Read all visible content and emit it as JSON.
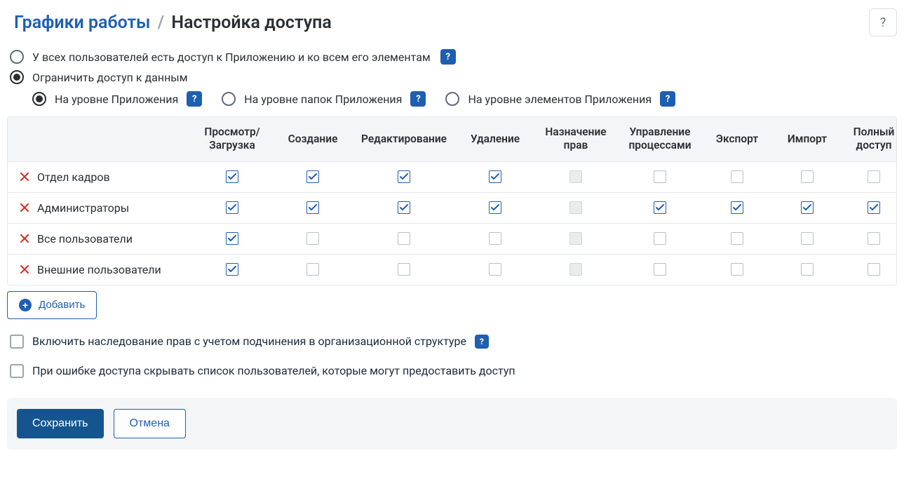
{
  "breadcrumb": {
    "parent": "Графики работы",
    "sep": "/",
    "current": "Настройка доступа"
  },
  "help_icon": "?",
  "access": {
    "opt_all": "У всех пользователей есть доступ к Приложению и ко всем его элементам",
    "opt_restrict": "Ограничить доступ к данным",
    "selected": "restrict",
    "level": {
      "app": "На уровне Приложения",
      "folders": "На уровне папок Приложения",
      "elements": "На уровне элементов Приложения",
      "selected": "app"
    }
  },
  "table": {
    "headers": {
      "name": "",
      "view": "Просмотр/\nЗагрузка",
      "create": "Создание",
      "edit": "Редактирование",
      "delete": "Удаление",
      "assign": "Назначение прав",
      "process": "Управление процессами",
      "export": "Экспорт",
      "import": "Импорт",
      "full": "Полный доступ"
    },
    "rows": [
      {
        "name": "Отдел кадров",
        "perms": {
          "view": true,
          "create": true,
          "edit": true,
          "delete": true,
          "assign": "dis",
          "process": false,
          "export": false,
          "import": false,
          "full": false
        }
      },
      {
        "name": "Администраторы",
        "perms": {
          "view": true,
          "create": true,
          "edit": true,
          "delete": true,
          "assign": "dis",
          "process": true,
          "export": true,
          "import": true,
          "full": true
        }
      },
      {
        "name": "Все пользователи",
        "perms": {
          "view": true,
          "create": false,
          "edit": false,
          "delete": false,
          "assign": "dis",
          "process": false,
          "export": false,
          "import": false,
          "full": false
        }
      },
      {
        "name": "Внешние пользователи",
        "perms": {
          "view": true,
          "create": false,
          "edit": false,
          "delete": false,
          "assign": "dis",
          "process": false,
          "export": false,
          "import": false,
          "full": false
        }
      }
    ]
  },
  "add_button": "Добавить",
  "options": {
    "inherit": "Включить наследование прав с учетом подчинения в организационной структуре",
    "hide_users": "При ошибке доступа скрывать список пользователей, которые могут предоставить доступ"
  },
  "footer": {
    "save": "Сохранить",
    "cancel": "Отмена"
  },
  "hint_glyph": "?"
}
